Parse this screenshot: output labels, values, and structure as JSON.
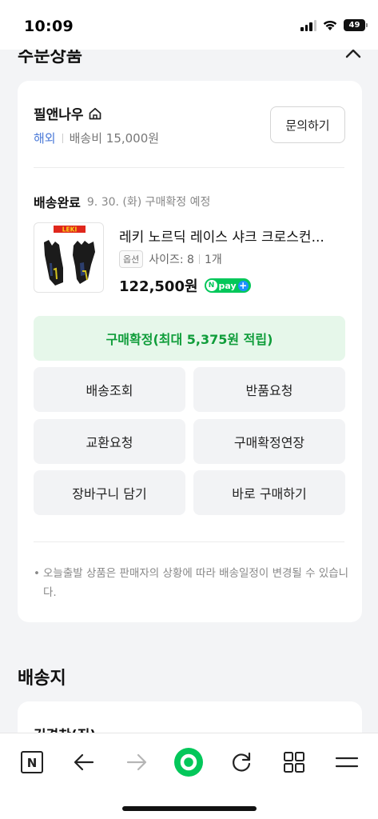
{
  "status_bar": {
    "time": "10:09",
    "battery": "49"
  },
  "section": {
    "title": "주문상품"
  },
  "store": {
    "name": "필앤나우",
    "overseas": "해외",
    "shipping_fee": "배송비 15,000원",
    "inquiry_button": "문의하기"
  },
  "order": {
    "status": "배송완료",
    "status_date": "9. 30. (화) 구매확정 예정",
    "product_name": "레키 노르딕 레이스 샤크 크로스컨...",
    "option_badge": "옵션",
    "option_value": "사이즈: 8",
    "quantity": "1개",
    "price": "122,500원",
    "npay_label": "pay",
    "thumb_brand": "LEKI"
  },
  "actions": {
    "confirm": "구매확정(최대 5,375원 적립)",
    "track": "배송조회",
    "return": "반품요청",
    "exchange": "교환요청",
    "extend": "구매확정연장",
    "cart": "장바구니 담기",
    "buy_now": "바로 구매하기"
  },
  "notice": "오늘출발 상품은 판매자의 상황에 따라 배송일정이 변경될 수 있습니다.",
  "delivery": {
    "title": "배송지",
    "recipient": "김경찬(집)"
  },
  "toolbar": {
    "n_label": "N"
  },
  "colors": {
    "naver_green": "#03c75a",
    "confirm_bg": "#e6f7ea",
    "confirm_text": "#0f9d3a",
    "link_blue": "#4a79d8"
  }
}
